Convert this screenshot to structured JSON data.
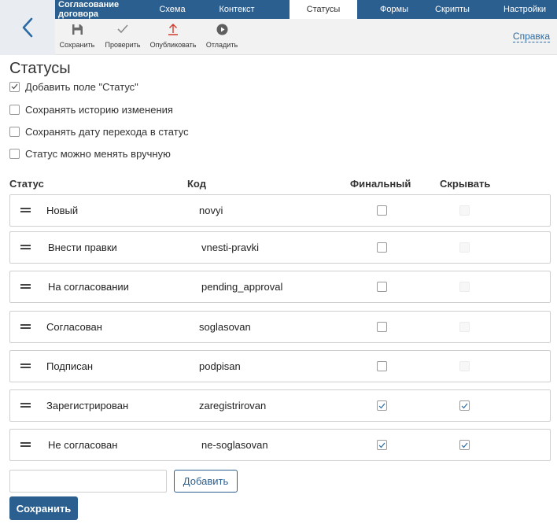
{
  "tabs": [
    {
      "label": "Согласование договора",
      "active": false
    },
    {
      "label": "Схема",
      "active": false
    },
    {
      "label": "Контекст",
      "active": false
    },
    {
      "label": "Статусы",
      "active": true
    },
    {
      "label": "Формы",
      "active": false
    },
    {
      "label": "Скрипты",
      "active": false
    },
    {
      "label": "Настройки",
      "active": false
    }
  ],
  "toolbar": {
    "save": {
      "label": "Сохранить",
      "icon": "floppy-disk-icon"
    },
    "check": {
      "label": "Проверить",
      "icon": "checkmark-icon"
    },
    "publish": {
      "label": "Опубликовать",
      "icon": "upload-arrow-icon"
    },
    "debug": {
      "label": "Отладить",
      "icon": "play-circle-icon"
    },
    "help": "Справка"
  },
  "page_title": "Статусы",
  "options": [
    {
      "label": "Добавить поле \"Статус\"",
      "checked": true
    },
    {
      "label": "Сохранять историю изменения",
      "checked": false
    },
    {
      "label": "Сохранять дату перехода в статус",
      "checked": false
    },
    {
      "label": "Статус можно менять вручную",
      "checked": false
    }
  ],
  "columns": {
    "status": "Статус",
    "code": "Код",
    "final": "Финальный",
    "hide": "Скрывать"
  },
  "statuses": [
    {
      "name": "Новый",
      "code": "novyi",
      "final": false,
      "hide": false,
      "hide_enabled": false
    },
    {
      "name": "Внести правки",
      "code": "vnesti-pravki",
      "final": false,
      "hide": false,
      "hide_enabled": false
    },
    {
      "name": "На согласовании",
      "code": "pending_approval",
      "final": false,
      "hide": false,
      "hide_enabled": false
    },
    {
      "name": "Согласован",
      "code": "soglasovan",
      "final": false,
      "hide": false,
      "hide_enabled": false
    },
    {
      "name": "Подписан",
      "code": "podpisan",
      "final": false,
      "hide": false,
      "hide_enabled": false
    },
    {
      "name": "Зарегистрирован",
      "code": "zaregistrirovan",
      "final": true,
      "hide": true,
      "hide_enabled": true
    },
    {
      "name": "Не согласован",
      "code": "ne-soglasovan",
      "final": true,
      "hide": true,
      "hide_enabled": true
    }
  ],
  "new_status": {
    "value": "",
    "placeholder": ""
  },
  "add_button": "Добавить",
  "save_button": "Сохранить",
  "colors": {
    "header": "#2b5f8f",
    "accent": "#2b6aa3",
    "back_bg": "#e9edf1"
  }
}
